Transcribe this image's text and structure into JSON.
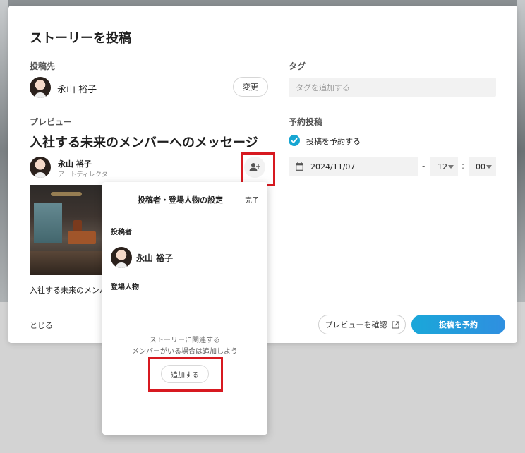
{
  "modal": {
    "title": "ストーリーを投稿",
    "destination_label": "投稿先",
    "destination_name": "永山 裕子",
    "change_label": "変更",
    "tag_label": "タグ",
    "tag_placeholder": "タグを追加する",
    "preview_label": "プレビュー",
    "preview_title": "入社する未来のメンバーへのメッセージ",
    "author_name": "永山 裕子",
    "author_role": "アートディレクター",
    "preview_text": "入社する未来のメンバ",
    "close_label": "とじる",
    "schedule_label": "予約投稿",
    "schedule_checkbox_label": "投稿を予約する",
    "schedule_date": "2024/11/07",
    "schedule_hour": "12",
    "schedule_minute": "00",
    "date_separator": "-",
    "time_separator": ":",
    "preview_button": "プレビューを確認",
    "submit_button": "投稿を予約"
  },
  "popover": {
    "title": "投稿者・登場人物の設定",
    "done": "完了",
    "poster_label": "投稿者",
    "poster_name": "永山 裕子",
    "people_label": "登場人物",
    "empty_line1": "ストーリーに関連する",
    "empty_line2": "メンバーがいる場合は追加しよう",
    "add_button": "追加する"
  },
  "colors": {
    "accent": "#17a6d2",
    "highlight": "#d71920"
  }
}
